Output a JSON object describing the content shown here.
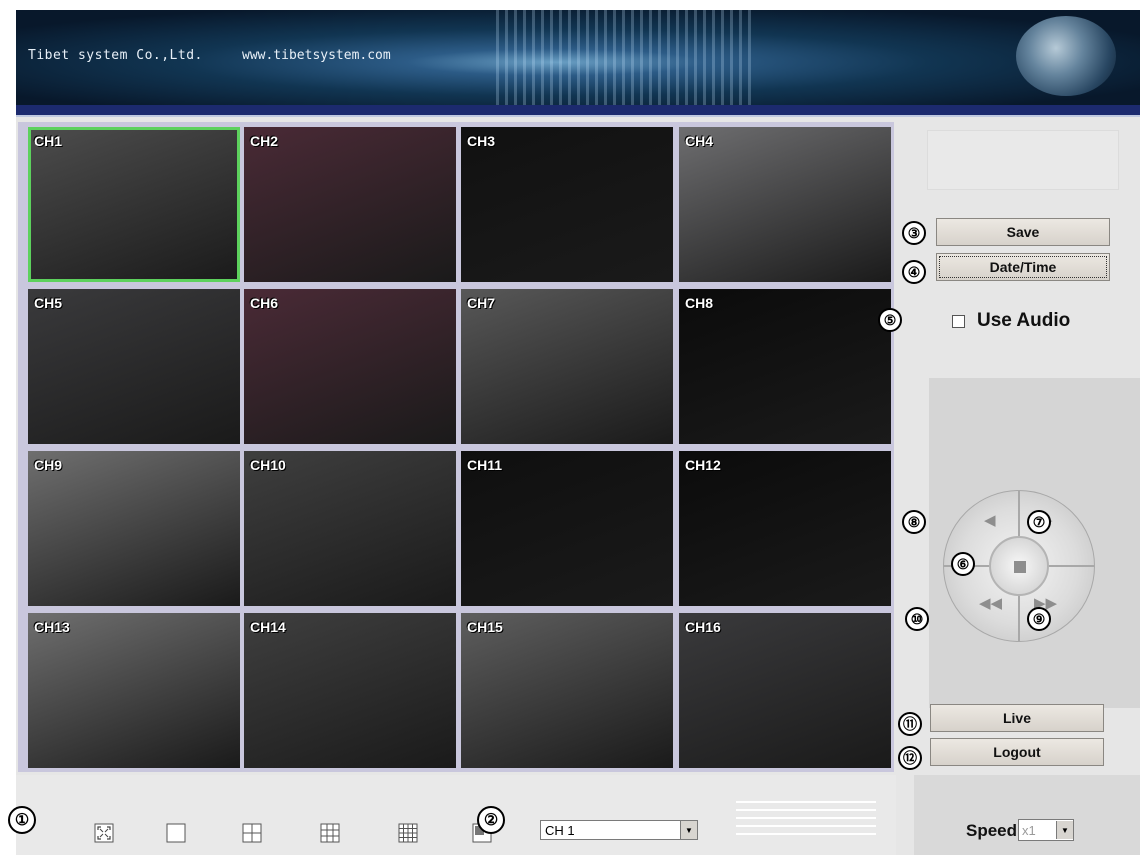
{
  "header": {
    "company": "Tibet system Co.,Ltd.",
    "website": "www.tibetsystem.com"
  },
  "grid": {
    "selected_channel": "CH1",
    "channels": [
      {
        "label": "CH1",
        "tone": "#4d4d4d"
      },
      {
        "label": "CH2",
        "tone": "#4a2a36"
      },
      {
        "label": "CH3",
        "tone": "#111111"
      },
      {
        "label": "CH4",
        "tone": "#6e6e70"
      },
      {
        "label": "CH5",
        "tone": "#3a3a3c"
      },
      {
        "label": "CH6",
        "tone": "#4a2a36"
      },
      {
        "label": "CH7",
        "tone": "#585858"
      },
      {
        "label": "CH8",
        "tone": "#0b0b0b"
      },
      {
        "label": "CH9",
        "tone": "#6f6f6f"
      },
      {
        "label": "CH10",
        "tone": "#3f3f3f"
      },
      {
        "label": "CH11",
        "tone": "#0f0f0f"
      },
      {
        "label": "CH12",
        "tone": "#0b0b0b"
      },
      {
        "label": "CH13",
        "tone": "#6f6f6f"
      },
      {
        "label": "CH14",
        "tone": "#3f3f3f"
      },
      {
        "label": "CH15",
        "tone": "#5e5e5e"
      },
      {
        "label": "CH16",
        "tone": "#3a3a3c"
      }
    ]
  },
  "sidebar": {
    "save_label": "Save",
    "datetime_label": "Date/Time",
    "use_audio_label": "Use Audio",
    "live_label": "Live",
    "logout_label": "Logout"
  },
  "markers": {
    "m1": "①",
    "m2": "②",
    "m3": "③",
    "m4": "④",
    "m5": "⑤",
    "m6": "⑥",
    "m7": "⑦",
    "m8": "⑧",
    "m9": "⑨",
    "m10": "⑩",
    "m11": "⑪",
    "m12": "⑫"
  },
  "bottom": {
    "channel_select_value": "CH 1",
    "speed_label": "Speed",
    "speed_value": "x1"
  },
  "colors": {
    "selected_border": "#5dd15d",
    "grid_bg": "#c9c7dd",
    "banner_bar": "#1c2a6e"
  }
}
